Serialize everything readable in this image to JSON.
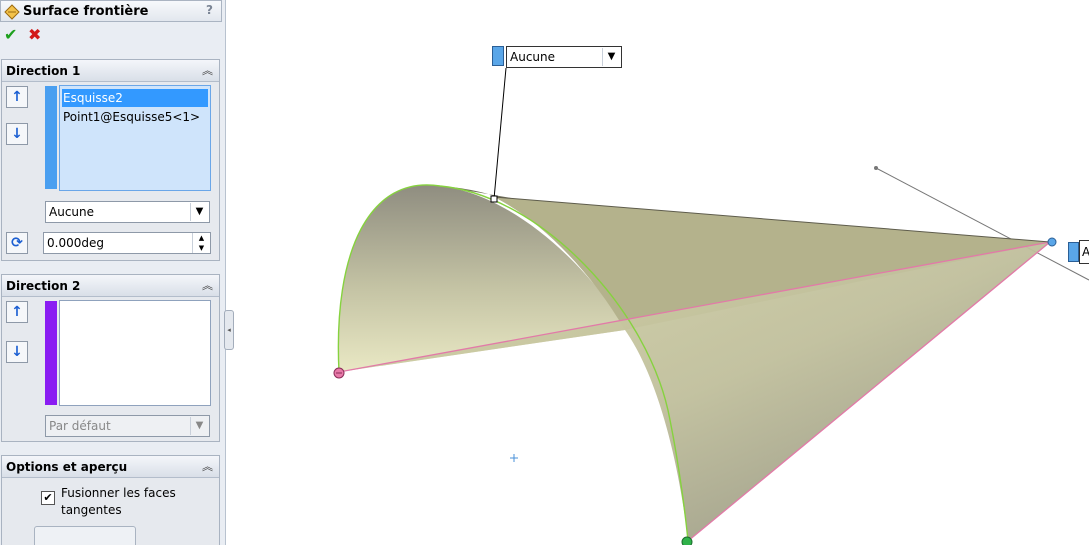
{
  "panel": {
    "title": "Surface frontière",
    "help_label": "?",
    "ok_label": "✔",
    "cancel_label": "✖"
  },
  "direction1": {
    "title": "Direction 1",
    "list_items": [
      "Esquisse2",
      "Point1@Esquisse5<1>"
    ],
    "selected_index": 0,
    "tangency": "Aucune",
    "angle_value": "0.000deg",
    "bar_color": "#4a9ff0"
  },
  "direction2": {
    "title": "Direction 2",
    "tangency": "Par défaut",
    "bar_color": "#8a1cf2"
  },
  "options": {
    "title": "Options et aperçu",
    "merge_label_line1": "Fusionner les faces",
    "merge_label_line2": "tangentes",
    "merge_checked": true
  },
  "viewport": {
    "callout_top": "Aucune",
    "callout_right": "A"
  },
  "colors": {
    "accent": "#1c5fd2",
    "selection": "#3399ff",
    "surface": "#c9c8a0",
    "edge_pink": "#e27aa8",
    "edge_green": "#7fcf3a"
  }
}
